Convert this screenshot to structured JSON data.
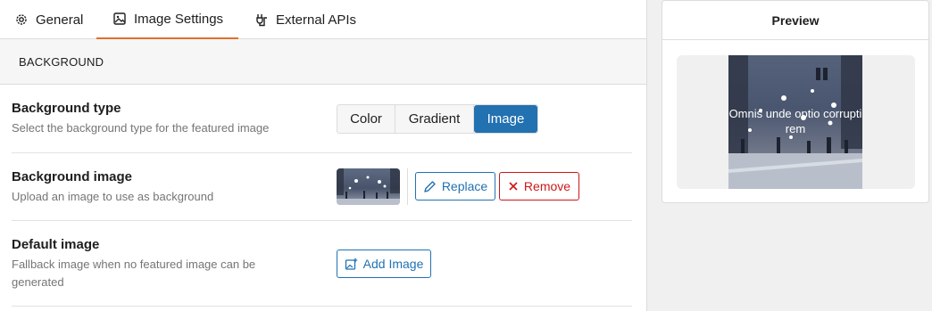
{
  "tabs": [
    {
      "label": "General",
      "icon": "gear-icon"
    },
    {
      "label": "Image Settings",
      "icon": "image-icon",
      "active": true
    },
    {
      "label": "External APIs",
      "icon": "plug-icon"
    }
  ],
  "section": {
    "title": "BACKGROUND"
  },
  "rows": {
    "background_type": {
      "title": "Background type",
      "description": "Select the background type for the featured image",
      "options": [
        "Color",
        "Gradient",
        "Image"
      ],
      "selected": "Image"
    },
    "background_image": {
      "title": "Background image",
      "description": "Upload an image to use as background",
      "replace_label": "Replace",
      "remove_label": "Remove"
    },
    "default_image": {
      "title": "Default image",
      "description": "Fallback image when no featured image can be generated",
      "add_label": "Add Image"
    }
  },
  "preview": {
    "title": "Preview",
    "overlay_text": "Omnis unde optio corrupti rem"
  },
  "colors": {
    "accent": "#2271b1",
    "tab_underline": "#e26f2c",
    "danger": "#cc1818"
  }
}
